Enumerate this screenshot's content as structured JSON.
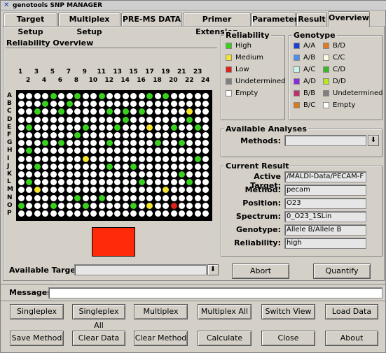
{
  "window": {
    "title": "genotools SNP MANAGER",
    "icon": "x-app-icon"
  },
  "tabs": [
    {
      "label": "Target Setup"
    },
    {
      "label": "Multiplex Setup"
    },
    {
      "label": "PRE-MS DATA"
    },
    {
      "label": "Primer Extension"
    },
    {
      "label": "Parameter"
    },
    {
      "label": "Result"
    },
    {
      "label": "Overview"
    }
  ],
  "active_tab": "Overview",
  "reliability_overview": {
    "title": "Reliability Overview",
    "column_numbers_top": [
      "1",
      "3",
      "5",
      "7",
      "9",
      "11",
      "13",
      "15",
      "17",
      "19",
      "21",
      "23"
    ],
    "column_numbers_bottom": [
      "2",
      "4",
      "6",
      "8",
      "10",
      "12",
      "14",
      "16",
      "18",
      "20",
      "22",
      "24"
    ],
    "row_labels": [
      "A",
      "B",
      "C",
      "D",
      "E",
      "F",
      "G",
      "H",
      "I",
      "J",
      "K",
      "L",
      "M",
      "N",
      "O",
      "P"
    ],
    "plate_rows": [
      "WWWWGWWGWWGWWWWWGWGWWWWW",
      "WWWGWWGWWWWWWWWWWWWWWWWW",
      "WWGWWGWWWWWGWGWGWWWWWYWW",
      "WWWWWWWWWWWWWGWWWWWWWGWW",
      "WGWWWWWWGWWWGWWWYWWGWWGW",
      "WWWWWWWGWWWWWWWWWWWWWWWW",
      "WWWGWGWWWWWGWWWWWGWWGWWW",
      "WGWWWWWWWWWWWWWWWWWWWWWW",
      "WWWWWWWWYWWWWWWWWWWWWWGW",
      "WWGWWWWWWWWGWWGWWWWWWWWW",
      "WWWWWWWWWWWWWWWWWWWWGWWW",
      "WGWWWWWWWWWWWWWGWWWWWGWW",
      "WWYWWWWWWWWWWWWWWWYWWWWW",
      "WWWWWWWGWWGWWWWWWWWWWWWW",
      "GWWWGWWWGWWWWWGWYWWRWWWW",
      "WWWWWWWWWWWWWWWWWWWWWWWW"
    ],
    "key": {
      "G": "#3ad11e",
      "Y": "#f2e52b",
      "R": "#e0211b",
      "W": "#ffffff"
    }
  },
  "reliability_legend": {
    "title": "Reliability",
    "items": [
      {
        "label": "High",
        "color": "#3ad11e"
      },
      {
        "label": "Medium",
        "color": "#f2e52b"
      },
      {
        "label": "Low",
        "color": "#e0211b"
      },
      {
        "label": "Undetermined",
        "color": "#808080"
      },
      {
        "label": "Empty",
        "color": "#ffffff"
      }
    ]
  },
  "genotype_legend": {
    "title": "Genotype",
    "items": [
      {
        "label": "A/A",
        "color": "#1e3cd6"
      },
      {
        "label": "B/D",
        "color": "#e07a20"
      },
      {
        "label": "A/B",
        "color": "#4a8ff0"
      },
      {
        "label": "C/C",
        "color": "#fdfbe0"
      },
      {
        "label": "A/C",
        "color": "#c8f4f0"
      },
      {
        "label": "C/D",
        "color": "#3ab82a"
      },
      {
        "label": "A/D",
        "color": "#8a2be2"
      },
      {
        "label": "D/D",
        "color": "#b8e820"
      },
      {
        "label": "B/B",
        "color": "#c02e6e"
      },
      {
        "label": "Undetermined",
        "color": "#808080"
      },
      {
        "label": "B/C",
        "color": "#d67a1a"
      },
      {
        "label": "Empty",
        "color": "#ffffff"
      }
    ]
  },
  "available_analyses": {
    "title": "Available Analyses",
    "methods_label": "Methods:",
    "methods_value": ""
  },
  "current_result": {
    "title": "Current Result",
    "fields": [
      {
        "label": "Active Target:",
        "value": "/MALDI-Data/PECAM-F"
      },
      {
        "label": "Method:",
        "value": "pecam"
      },
      {
        "label": "Position:",
        "value": "O23"
      },
      {
        "label": "Spectrum:",
        "value": "0_O23_1SLin"
      },
      {
        "label": "Genotype:",
        "value": "Allele B/Allele B"
      },
      {
        "label": "Reliability:",
        "value": "high"
      }
    ]
  },
  "selected_well_color": "#ff2a0a",
  "available_targets": {
    "label": "Available Targets:",
    "value": ""
  },
  "actions": {
    "abort": "Abort",
    "quantify": "Quantify"
  },
  "messages": {
    "label": "Messages:",
    "value": ""
  },
  "buttons_row1": [
    "Singleplex",
    "Singleplex All",
    "Multiplex",
    "Multiplex All",
    "Switch View",
    "Load Data"
  ],
  "buttons_row2": [
    "Save Method",
    "Clear Data",
    "Clear Method",
    "Calculate",
    "Close",
    "About"
  ]
}
